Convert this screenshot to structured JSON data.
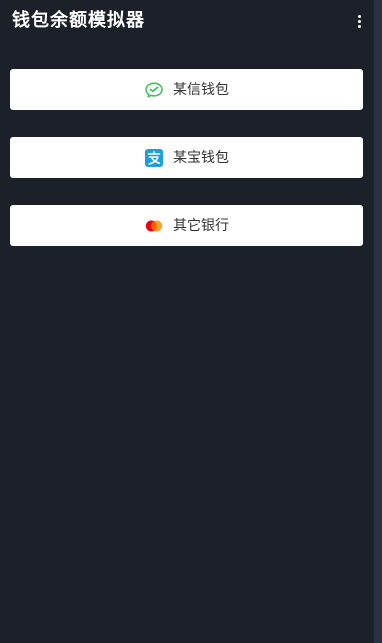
{
  "app": {
    "title": "钱包余额模拟器"
  },
  "toolbar": {
    "more_icon": "more-vert-icon"
  },
  "options": [
    {
      "label": "某信钱包",
      "icon": "wechat-icon",
      "color": "#3cbf4f"
    },
    {
      "label": "某宝钱包",
      "icon": "alipay-icon",
      "color": "#1a9fe0"
    },
    {
      "label": "其它银行",
      "icon": "mastercard-icon",
      "color": "#eb001b"
    }
  ],
  "colors": {
    "background": "#1b2029",
    "card": "#ffffff",
    "text_primary": "#ffffff",
    "text_card": "#333333"
  }
}
